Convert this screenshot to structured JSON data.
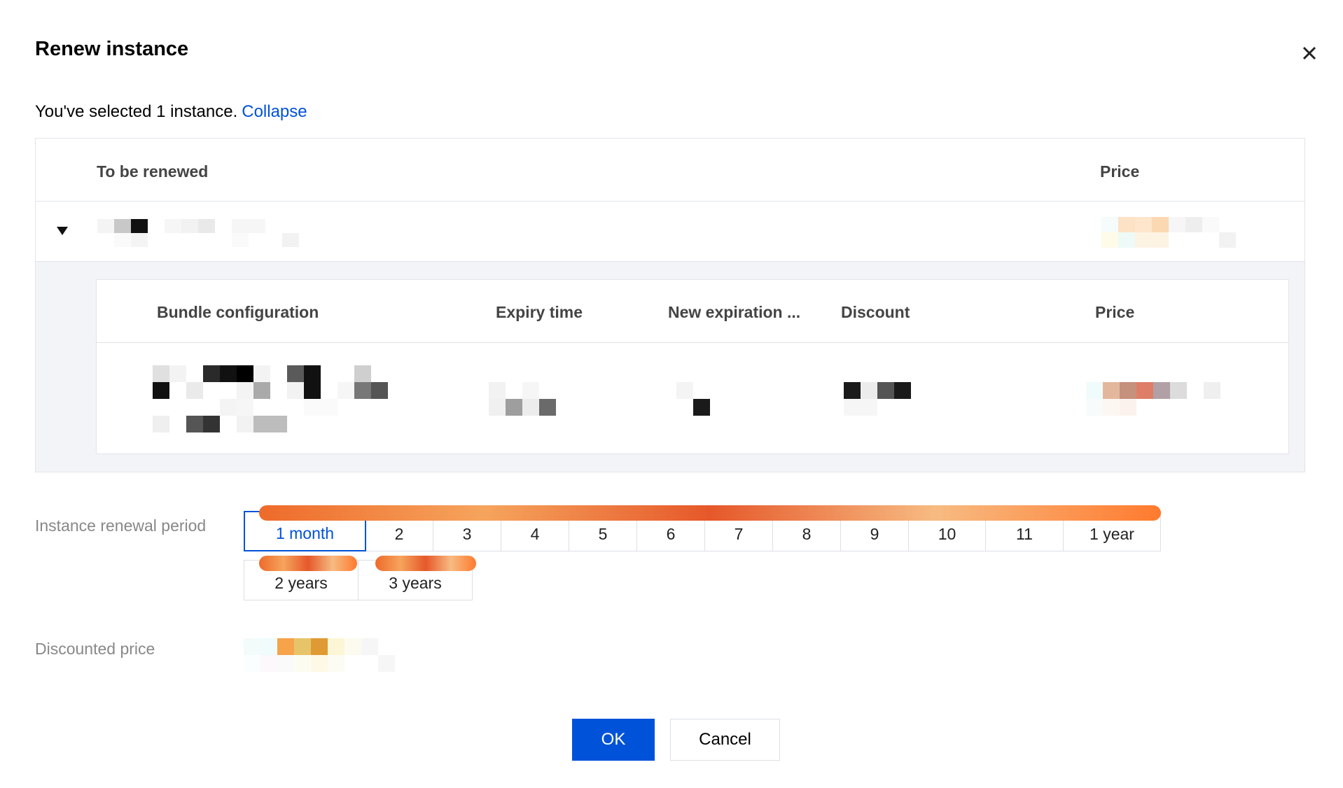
{
  "dialog": {
    "title": "Renew instance",
    "selected_text": "You've selected 1 instance.",
    "collapse_link": "Collapse"
  },
  "outer_table": {
    "columns": [
      "To be renewed",
      "Price"
    ]
  },
  "inner_table": {
    "columns": [
      "Bundle configuration",
      "Expiry time",
      "New expiration ...",
      "Discount",
      "Price"
    ]
  },
  "renewal": {
    "label": "Instance renewal period",
    "options": [
      "1 month",
      "2",
      "3",
      "4",
      "5",
      "6",
      "7",
      "8",
      "9",
      "10",
      "11",
      "1 year",
      "2 years",
      "3 years"
    ],
    "selected": "1 month"
  },
  "discounted_price": {
    "label": "Discounted price"
  },
  "actions": {
    "ok": "OK",
    "cancel": "Cancel"
  },
  "colors": {
    "primary": "#0052d9",
    "border": "#e1e4ea",
    "expanded_bg": "#f3f4f7",
    "badge_orange": "#ee6a2a"
  }
}
